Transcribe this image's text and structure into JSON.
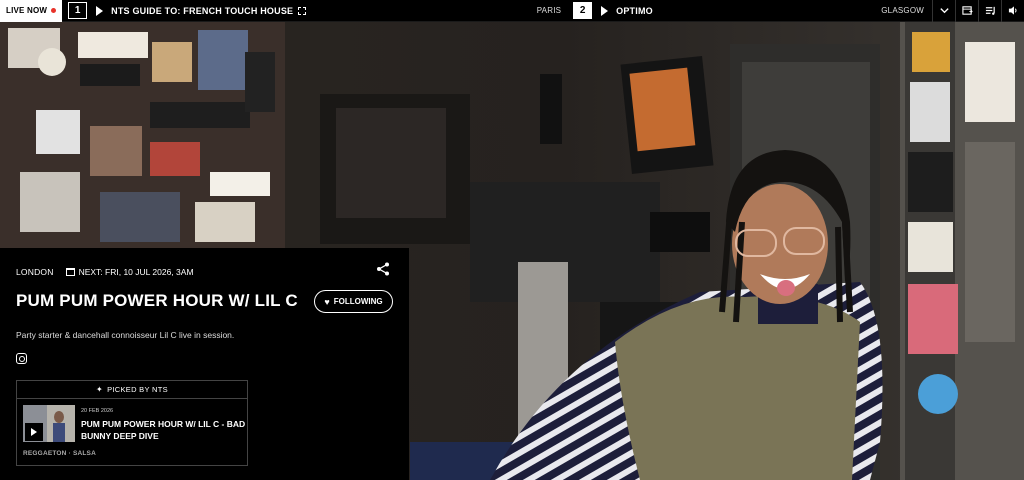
{
  "topbar": {
    "live_label": "LIVE NOW",
    "channels": [
      {
        "number": "1",
        "title": "NTS GUIDE TO: FRENCH TOUCH HOUSE",
        "location": "PARIS"
      },
      {
        "number": "2",
        "title": "OPTIMO",
        "location": "GLASGOW"
      }
    ],
    "icons": [
      "chevron-down-icon",
      "schedule-icon",
      "playlist-icon",
      "volume-icon"
    ]
  },
  "show": {
    "location": "LONDON",
    "next_airing": "NEXT: FRI, 10 JUL 2026, 3AM",
    "title": "PUM PUM POWER HOUR W/ LIL C",
    "follow_label": "FOLLOWING",
    "description": "Party starter & dancehall connoisseur Lil C live in session."
  },
  "picked": {
    "heading": "PICKED BY NTS",
    "episode": {
      "date": "20 FEB 2026",
      "title": "PUM PUM POWER HOUR W/ LIL C - BAD BUNNY DEEP DIVE",
      "genres": "REGGAETON · SALSA"
    }
  },
  "colors": {
    "live_dot": "#e8332a",
    "background": "#000000",
    "text": "#ffffff"
  }
}
